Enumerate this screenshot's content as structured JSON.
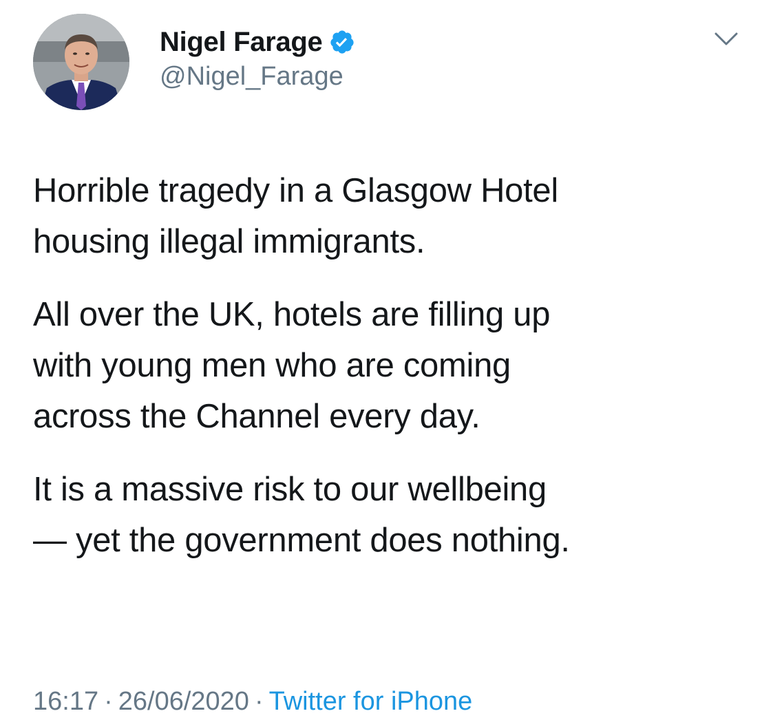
{
  "tweet": {
    "author": {
      "display_name": "Nigel Farage",
      "handle": "@Nigel_Farage",
      "verified": true,
      "verified_icon": "verified-badge-icon",
      "avatar_icon": "profile-photo"
    },
    "menu_icon": "chevron-down-icon",
    "paragraphs": [
      "Horrible tragedy in a Glasgow Hotel\nhousing illegal immigrants.",
      "All over the UK, hotels are filling up\nwith young men who are coming\nacross the Channel every day.",
      "It is a massive risk to our wellbeing\n— yet the government does nothing."
    ],
    "time": "16:17",
    "separator": "·",
    "date": "26/06/2020",
    "client": "Twitter for iPhone"
  },
  "colors": {
    "text_primary": "#14171a",
    "text_secondary": "#657786",
    "link": "#1b95e0",
    "verified_badge": "#1da1f2",
    "background": "#ffffff"
  }
}
